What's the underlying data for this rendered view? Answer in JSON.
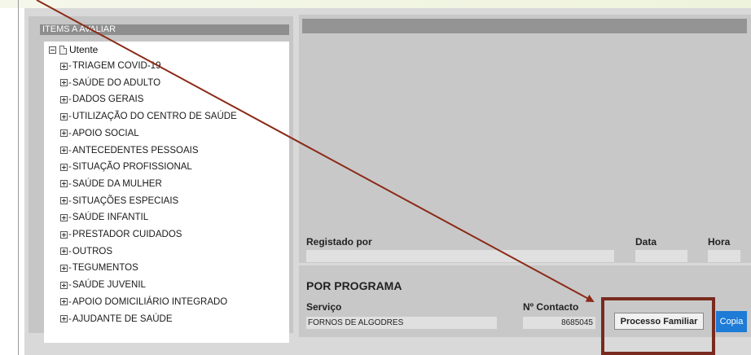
{
  "left_panel": {
    "header": "ITEMS A AVALIAR",
    "root_label": "Utente",
    "items": [
      {
        "label": "TRIAGEM COVID-19"
      },
      {
        "label": "SAÚDE DO ADULTO"
      },
      {
        "label": "DADOS GERAIS"
      },
      {
        "label": "UTILIZAÇÃO DO CENTRO DE SAÚDE"
      },
      {
        "label": "APOIO SOCIAL"
      },
      {
        "label": "ANTECEDENTES PESSOAIS"
      },
      {
        "label": "SITUAÇÃO PROFISSIONAL"
      },
      {
        "label": "SAÚDE DA MULHER"
      },
      {
        "label": "SITUAÇÕES ESPECIAIS"
      },
      {
        "label": "SAÚDE INFANTIL"
      },
      {
        "label": "PRESTADOR CUIDADOS"
      },
      {
        "label": "OUTROS"
      },
      {
        "label": "TEGUMENTOS"
      },
      {
        "label": "SAÚDE JUVENIL"
      },
      {
        "label": "APOIO DOMICILIÁRIO INTEGRADO"
      },
      {
        "label": "AJUDANTE DE SAÚDE"
      }
    ]
  },
  "record": {
    "registado_por_label": "Registado por",
    "data_label": "Data",
    "hora_label": "Hora"
  },
  "programa": {
    "title": "POR PROGRAMA",
    "servico_label": "Serviço",
    "servico_value": "FORNOS DE ALGODRES",
    "contacto_label": "Nº Contacto",
    "contacto_value": "8685045",
    "processo_button": "Processo Familiar",
    "copia_button": "Copia"
  },
  "colors": {
    "annotation_arrow": "#8b2a17",
    "highlight_box": "#7a2a1e",
    "copia_button_bg": "#1e7bd6"
  }
}
